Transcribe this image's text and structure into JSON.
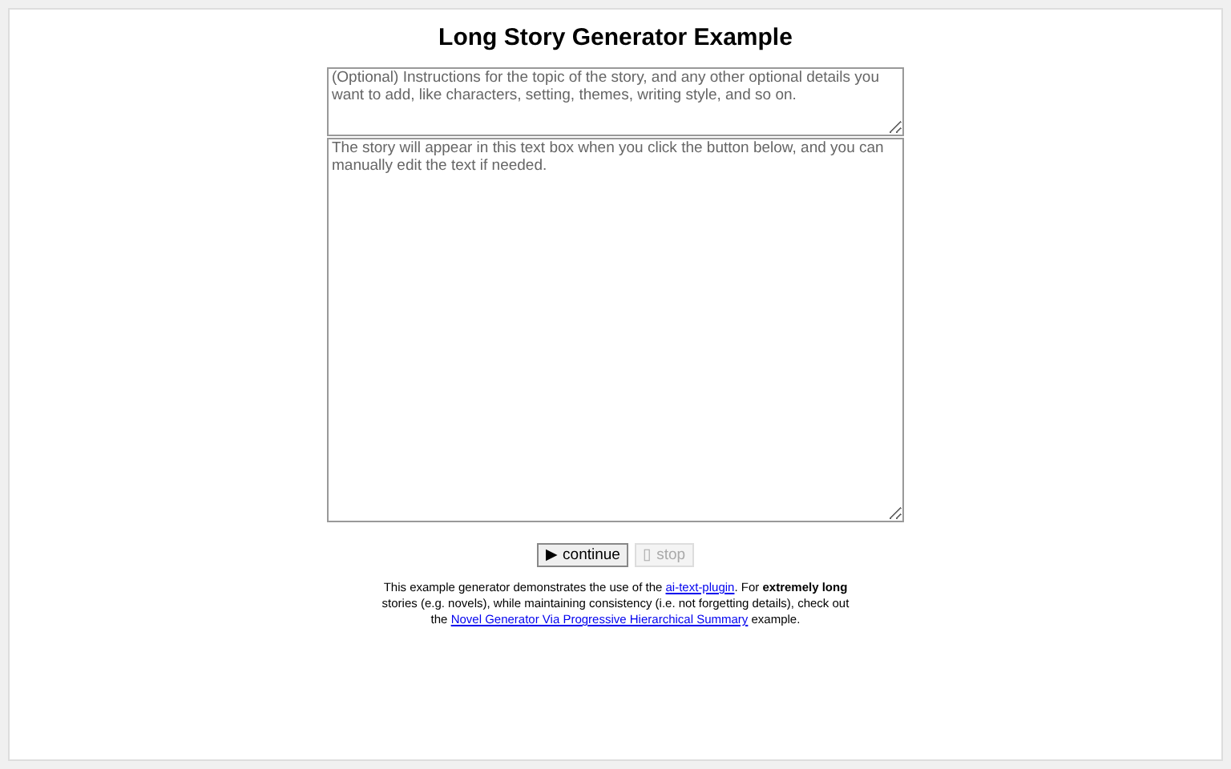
{
  "title": "Long Story Generator Example",
  "instructions_field": {
    "placeholder": "(Optional) Instructions for the topic of the story, and any other optional details you want to add, like characters, setting, themes, writing style, and so on."
  },
  "story_field": {
    "placeholder": "The story will appear in this text box when you click the button below, and you can manually edit the text if needed."
  },
  "buttons": [
    {
      "label": "▶ continue",
      "disabled": false
    },
    {
      "label": "▯ stop",
      "disabled": true
    }
  ],
  "footer": {
    "parts": [
      {
        "kind": "text",
        "text": "This example generator demonstrates the use of the "
      },
      {
        "kind": "link",
        "text": "ai-text-plugin"
      },
      {
        "kind": "text",
        "text": ". For **extremely long** stories (e.g. novels), while maintaining consistency (i.e. not forgetting details), check out the "
      },
      {
        "kind": "link",
        "text": "Novel Generator Via Progressive Hierarchical Summary"
      },
      {
        "kind": "text",
        "text": " example."
      }
    ]
  }
}
